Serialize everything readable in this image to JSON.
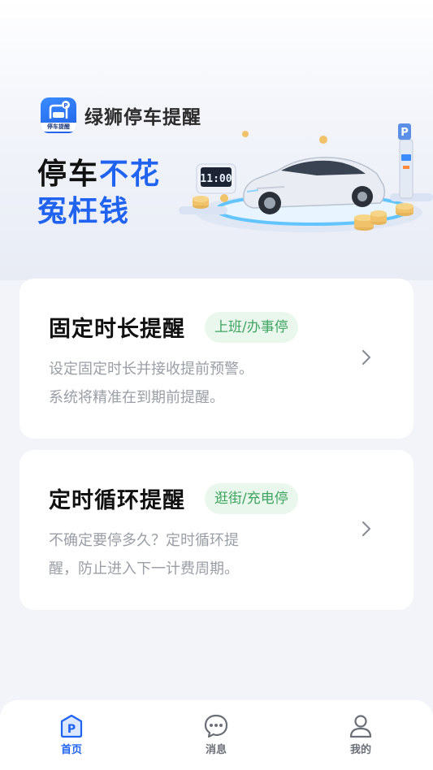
{
  "app": {
    "name": "绿狮停车提醒",
    "icon_label": "停车提醒",
    "icon": "parking-car-icon"
  },
  "hero": {
    "slogan_line1_dark": "停车",
    "slogan_line1_blue": "不花",
    "slogan_line2_blue": "冤枉钱",
    "clock_display": "11:00",
    "parking_sign": "P"
  },
  "cards": [
    {
      "title": "固定时长提醒",
      "tag": "上班/办事停",
      "desc_line1": "设定固定时长并接收提前预警。",
      "desc_line2": "系统将精准在到期前提醒。",
      "icon": "chevron-right-icon"
    },
    {
      "title": "定时循环提醒",
      "tag": "逛街/充电停",
      "desc_line1": "不确定要停多久？定时循环提",
      "desc_line2": "醒，防止进入下一计费周期。",
      "icon": "chevron-right-icon"
    }
  ],
  "tabbar": {
    "items": [
      {
        "label": "首页",
        "icon": "parking-icon",
        "active": true
      },
      {
        "label": "消息",
        "icon": "chat-bubble-icon",
        "active": false
      },
      {
        "label": "我的",
        "icon": "user-icon",
        "active": false
      }
    ]
  },
  "colors": {
    "accent": "#1f63f0",
    "tag_bg": "#eaf7ec",
    "tag_text": "#3ea560",
    "background": "#f3f4f9"
  }
}
